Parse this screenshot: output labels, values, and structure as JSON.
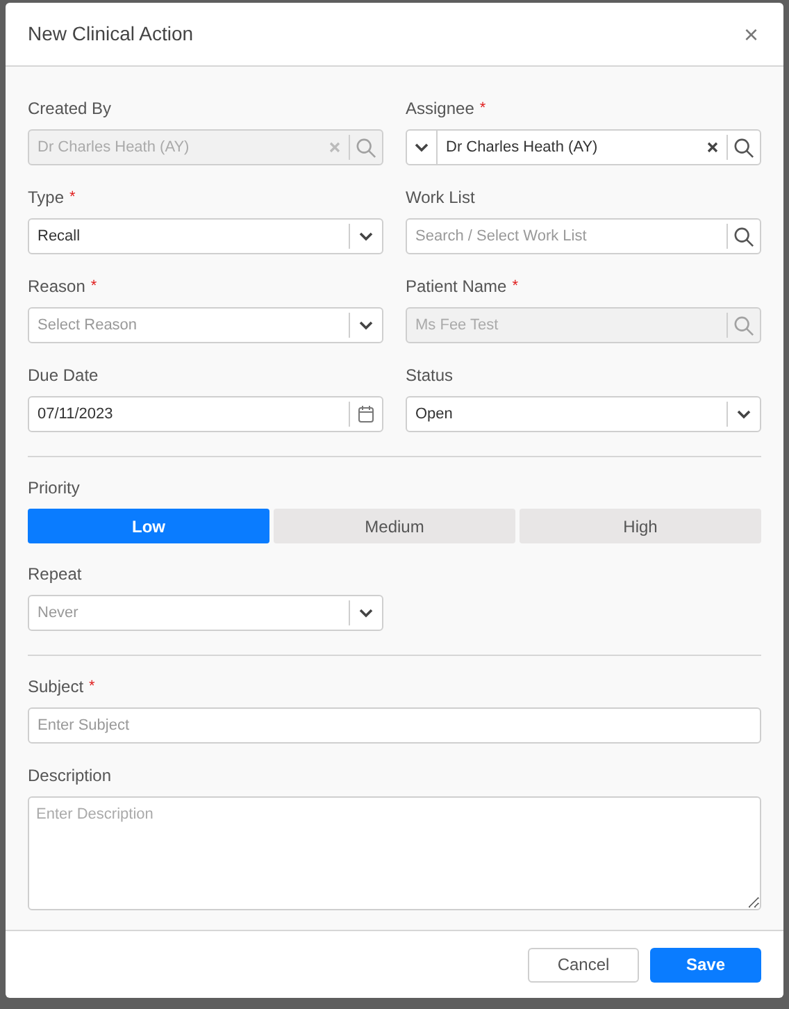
{
  "dialog": {
    "title": "New Clinical Action",
    "close": "×"
  },
  "fields": [
    {
      "label": "Created By",
      "kind": "search",
      "value": "Dr Charles Heath (AY)",
      "disabled": true,
      "clearable": true,
      "left_dropdown": false
    },
    {
      "label": "Assignee",
      "required_mark": "*",
      "kind": "search",
      "value": "Dr Charles Heath (AY)",
      "disabled": false,
      "clearable": true,
      "left_dropdown": true
    },
    {
      "label": "Type",
      "required_mark": "*",
      "kind": "select",
      "value": "Recall",
      "disabled": false,
      "clearable": false,
      "left_dropdown": false
    },
    {
      "label": "Work List",
      "kind": "search",
      "placeholder": "Search / Select Work List",
      "disabled": false,
      "clearable": false,
      "left_dropdown": false
    },
    {
      "label": "Reason",
      "required_mark": "*",
      "kind": "select",
      "placeholder": "Select Reason",
      "disabled": false,
      "clearable": false,
      "left_dropdown": false
    },
    {
      "label": "Patient Name",
      "required_mark": "*",
      "kind": "search",
      "placeholder": "Ms Fee Test",
      "disabled": true,
      "clearable": false,
      "left_dropdown": false
    },
    {
      "label": "Due Date",
      "kind": "date",
      "value": "07/11/2023",
      "disabled": false,
      "clearable": false,
      "left_dropdown": false
    },
    {
      "label": "Status",
      "kind": "select",
      "value": "Open",
      "disabled": false,
      "clearable": false,
      "left_dropdown": false
    }
  ],
  "priority": {
    "label": "Priority",
    "options": [
      {
        "label": "Low",
        "selected": true
      },
      {
        "label": "Medium",
        "selected": false
      },
      {
        "label": "High",
        "selected": false
      }
    ]
  },
  "repeat": {
    "label": "Repeat",
    "kind": "select",
    "placeholder": "Never",
    "disabled": false,
    "clearable": false,
    "left_dropdown": false
  },
  "subject": {
    "label": "Subject",
    "required_mark": "*",
    "kind": "text",
    "placeholder": "Enter Subject",
    "disabled": false,
    "clearable": false,
    "left_dropdown": false
  },
  "description": {
    "label": "Description",
    "kind": "textarea",
    "placeholder": "Enter Description",
    "disabled": false
  },
  "buttons": [
    {
      "label": "Cancel",
      "kind": "secondary"
    },
    {
      "label": "Save",
      "kind": "primary"
    }
  ]
}
